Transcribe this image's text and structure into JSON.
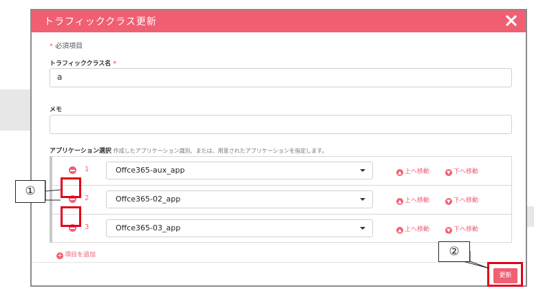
{
  "dialog": {
    "title": "トラフィッククラス更新",
    "required_note": "必須項目",
    "required_mark": "*"
  },
  "form": {
    "name_label": "トラフィッククラス名",
    "name_value": "a",
    "memo_label": "メモ",
    "memo_value": "",
    "app_label": "アプリケーション選択",
    "app_hint": "作成したアプリケーション識別、または、用意されたアプリケーションを指定します。"
  },
  "applications": [
    {
      "num": "1",
      "value": "Offce365-aux_app"
    },
    {
      "num": "2",
      "value": "Offce365-02_app"
    },
    {
      "num": "3",
      "value": "Offce365-03_app"
    }
  ],
  "actions": {
    "move_up": "上へ移動",
    "move_down": "下へ移動",
    "add_item": "項目を追加",
    "update": "更新"
  },
  "callouts": {
    "one": "①",
    "two": "②"
  },
  "colors": {
    "accent": "#f05f72",
    "highlight": "#e10019"
  },
  "icons": {
    "close": "close-icon",
    "remove": "minus-circle-icon",
    "up": "arrow-up-circle-icon",
    "down": "arrow-down-circle-icon",
    "add": "plus-circle-icon",
    "caret": "caret-down-icon"
  }
}
